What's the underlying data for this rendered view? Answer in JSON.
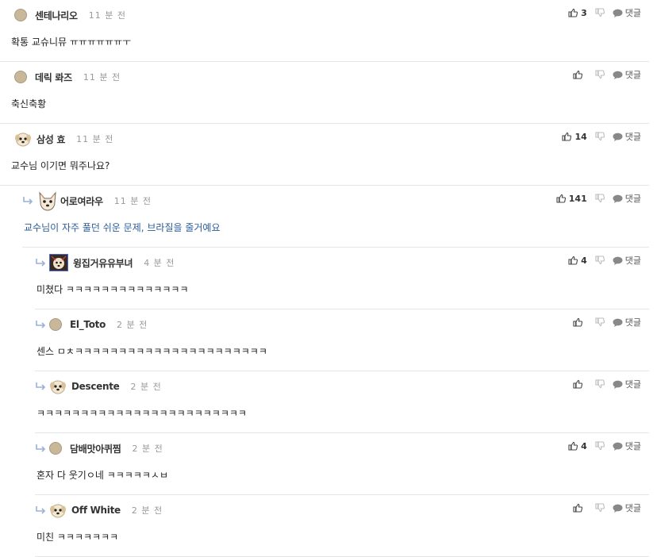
{
  "reply_label": "댓글",
  "comments": [
    {
      "name": "센테나리오",
      "time": "11 분 전",
      "body": "확통 교슈니뮤 ㅠㅠㅠㅠㅠㅠㅜ",
      "likes": "3",
      "avatar": "dot",
      "depth": 0
    },
    {
      "name": "데릭 롸즈",
      "time": "11 분 전",
      "body": "축신축황",
      "likes": "",
      "avatar": "dot",
      "depth": 0
    },
    {
      "name": "삼성 효",
      "time": "11 분 전",
      "body": "교수님 이기면 뭐주나요?",
      "likes": "14",
      "avatar": "dog",
      "depth": 0
    },
    {
      "name": "어로여라우",
      "time": "11 분 전",
      "body": "교수님이 자주 풀던 쉬운 문제, 브라질을 줄거예요",
      "likes": "141",
      "avatar": "cat",
      "depth": 1,
      "highlight": true
    },
    {
      "name": "윙집거유유부녀",
      "time": "4 분 전",
      "body": "미쳤다 ㅋㅋㅋㅋㅋㅋㅋㅋㅋㅋㅋㅋㅋㅋ",
      "likes": "4",
      "avatar": "pic",
      "depth": 2
    },
    {
      "name": "El_Toto",
      "time": "2 분 전",
      "body": "센스 ㅁㅊㅋㅋㅋㅋㅋㅋㅋㅋㅋㅋㅋㅋㅋㅋㅋㅋㅋㅋㅋㅋㅋㅋ",
      "likes": "",
      "avatar": "dot",
      "depth": 2
    },
    {
      "name": "Descente",
      "time": "2 분 전",
      "body": "ㅋㅋㅋㅋㅋㅋㅋㅋㅋㅋㅋㅋㅋㅋㅋㅋㅋㅋㅋㅋㅋㅋㅋㅋ",
      "likes": "",
      "avatar": "dog",
      "depth": 2
    },
    {
      "name": "담배맛아퀴찜",
      "time": "2 분 전",
      "body": "혼자 다 웃기ㅇ네 ㅋㅋㅋㅋㅋㅅㅂ",
      "likes": "4",
      "avatar": "dot",
      "depth": 2
    },
    {
      "name": "Off White",
      "time": "2 분 전",
      "body": "미친 ㅋㅋㅋㅋㅋㅋㅋ",
      "likes": "",
      "avatar": "dog",
      "depth": 2
    }
  ]
}
